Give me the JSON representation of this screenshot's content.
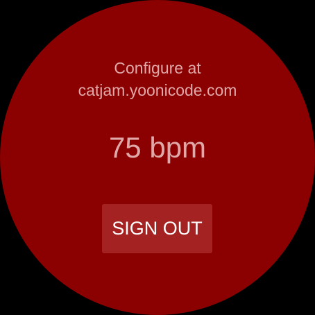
{
  "config": {
    "line1": "Configure at",
    "line2": "catjam.yoonicode.com"
  },
  "heart_rate": {
    "label": "75 bpm"
  },
  "sign_out": {
    "label": "SIGN OUT"
  },
  "colors": {
    "background": "#8b0000",
    "button": "#a52222",
    "text": "#e0a8a8"
  }
}
